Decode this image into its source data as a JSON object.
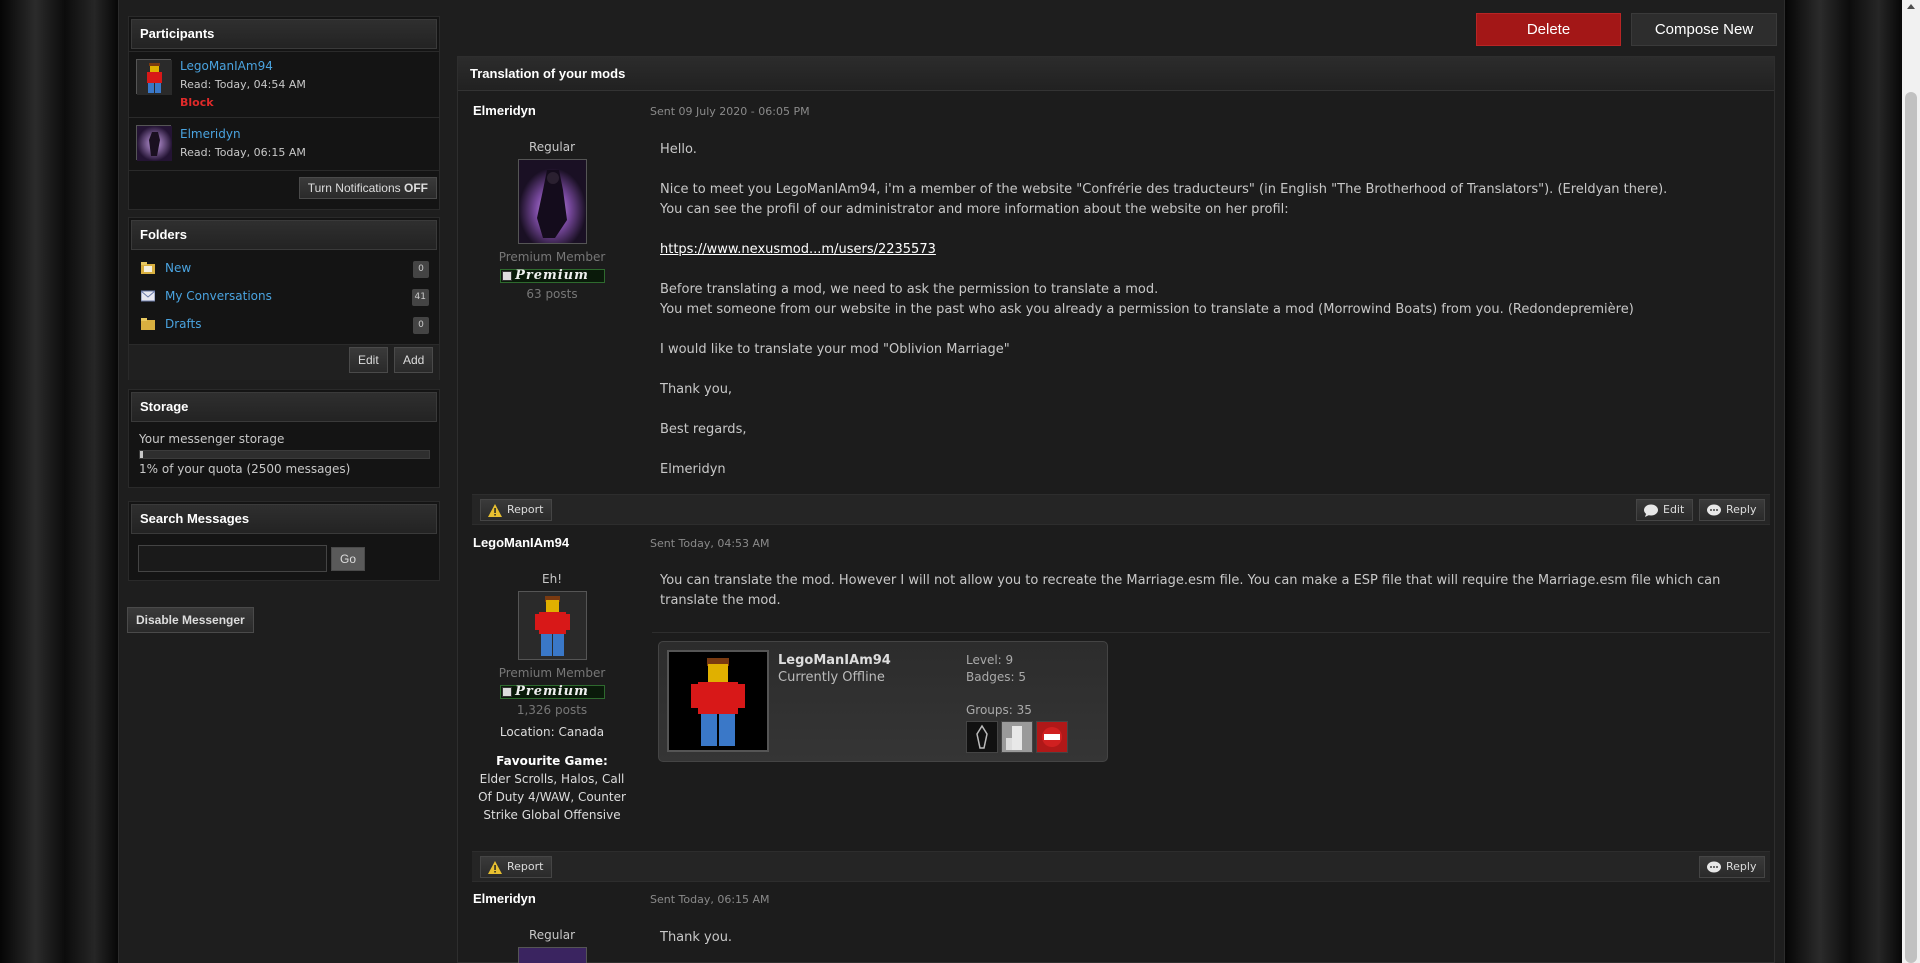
{
  "participants": {
    "title": "Participants",
    "list": [
      {
        "name": "LegoManIAm94",
        "read": "Read: Today, 04:54 AM",
        "action": "Block"
      },
      {
        "name": "Elmeridyn",
        "read": "Read: Today, 06:15 AM"
      }
    ],
    "notify_label": "Turn Notifications",
    "notify_state": "OFF"
  },
  "folders": {
    "title": "Folders",
    "items": [
      {
        "label": "New",
        "count": "0"
      },
      {
        "label": "My Conversations",
        "count": "41"
      },
      {
        "label": "Drafts",
        "count": "0"
      }
    ],
    "edit_label": "Edit",
    "add_label": "Add"
  },
  "storage": {
    "title": "Storage",
    "label": "Your messenger storage",
    "usage_text": "1% of your quota (2500 messages)",
    "usage_percent": 1
  },
  "search": {
    "title": "Search Messages",
    "value": "",
    "go_label": "Go"
  },
  "disable_label": "Disable Messenger",
  "actions": {
    "delete": "Delete",
    "compose": "Compose New"
  },
  "thread": {
    "title": "Translation of your mods",
    "messages": [
      {
        "author": "Elmeridyn",
        "date": "Sent 09 July 2020 - 06:05 PM",
        "user_title": "Regular",
        "rank": "Premium Member",
        "badge": "Premium",
        "posts": "63 posts",
        "lines": [
          "Hello.",
          "",
          "Nice to meet you LegoManIAm94, i'm a member of the website \"Confrérie des traducteurs\" (in English \"The Brotherhood of Translators\"). (Ereldyan there).",
          "You can see the profil of our administrator and more information about the website on her profil:",
          "",
          "Before translating a mod, we need to ask the permission to translate a mod.",
          "You met someone from our website in the past who ask you already a permission to translate a mod (Morrowind Boats) from you. (Redondepremière)",
          "",
          "I would like to translate your mod \"Oblivion Marriage\"",
          "",
          "Thank you,",
          "",
          "Best regards,",
          "",
          "Elmeridyn"
        ],
        "link": "https://www.nexusmod...m/users/2235573",
        "report": "Report",
        "edit": "Edit",
        "reply": "Reply"
      },
      {
        "author": "LegoManIAm94",
        "date": "Sent Today, 04:53 AM",
        "user_title": "Eh!",
        "rank": "Premium Member",
        "badge": "Premium",
        "posts": "1,326 posts",
        "location": "Location: Canada",
        "fav_label": "Favourite Game:",
        "fav_value": "Elder Scrolls, Halos, Call Of Duty 4/WAW, Counter Strike Global Offensive",
        "text": "You can translate the mod. However I will not allow you to recreate the Marriage.esm file. You can make a ESP file that will require the Marriage.esm file which can translate the mod.",
        "signature": {
          "name": "LegoManIAm94",
          "status": "Currently Offline",
          "level": "Level: 9",
          "badges": "Badges: 5",
          "groups": "Groups: 35"
        },
        "report": "Report",
        "reply": "Reply"
      },
      {
        "author": "Elmeridyn",
        "date": "Sent Today, 06:15 AM",
        "user_title": "Regular",
        "text": "Thank you."
      }
    ]
  },
  "colors": {
    "accent_link": "#4aa3df",
    "danger": "#a31717",
    "block": "#e02a2a"
  }
}
